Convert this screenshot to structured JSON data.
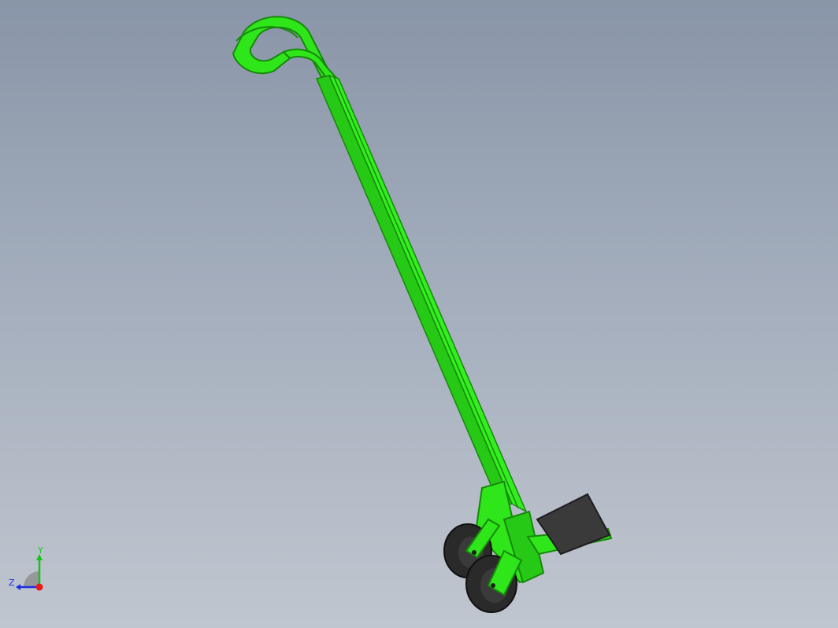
{
  "viewport": {
    "background_top": "#8995a8",
    "background_bottom": "#c0c6cf"
  },
  "model": {
    "part": "hand-truck",
    "body_color": "#2ee619",
    "body_dark": "#17880c",
    "plate_color": "#3a3a3a",
    "wheel_color": "#2a2a2a"
  },
  "triad": {
    "y_label": "Y",
    "z_label": "Z",
    "y_color": "#19c419",
    "z_color": "#1a2ee6",
    "x_color": "#e61919"
  }
}
